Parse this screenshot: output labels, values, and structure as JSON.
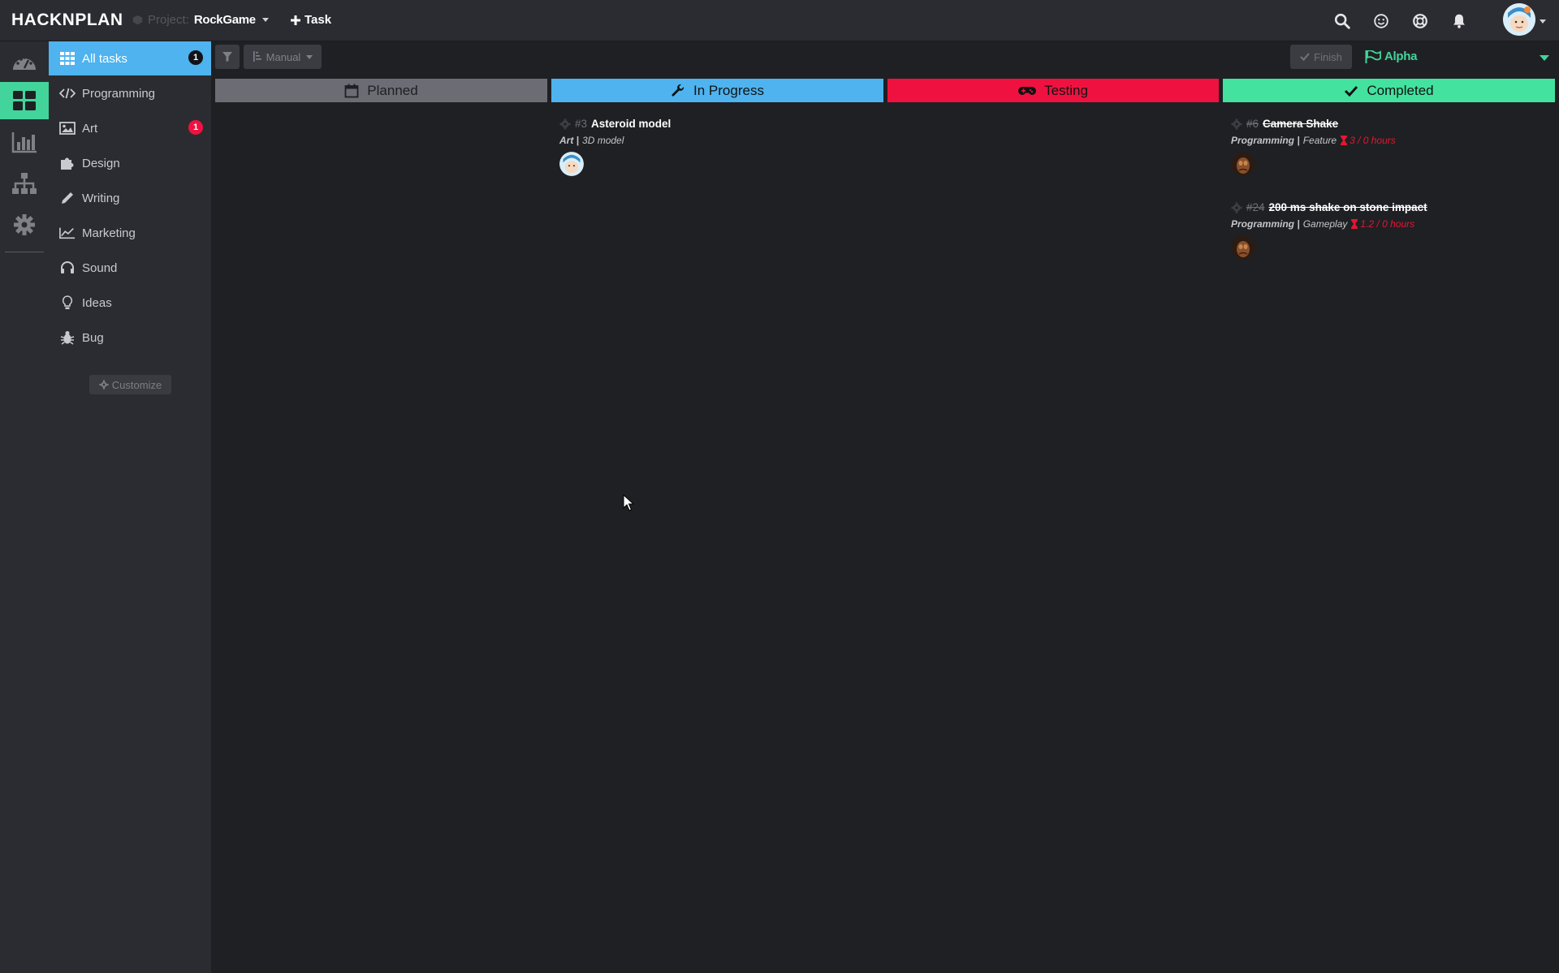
{
  "app": {
    "logo": "HACKNPLAN",
    "project_label": "Project:",
    "project_name": "RockGame",
    "add_task_label": "Task"
  },
  "topbar_icons": [
    "search-icon",
    "smiley-icon",
    "lifebuoy-icon",
    "bell-icon"
  ],
  "rail": [
    "dashboard-icon",
    "board-icon",
    "chart-icon",
    "hierarchy-icon",
    "gear-icon"
  ],
  "sidebar": {
    "items": [
      {
        "label": "All tasks",
        "icon": "grid-icon",
        "badge": "1"
      },
      {
        "label": "Programming",
        "icon": "code-icon",
        "badge": ""
      },
      {
        "label": "Art",
        "icon": "image-icon",
        "badge": "1"
      },
      {
        "label": "Design",
        "icon": "puzzle-icon",
        "badge": ""
      },
      {
        "label": "Writing",
        "icon": "pencil-icon",
        "badge": ""
      },
      {
        "label": "Marketing",
        "icon": "line-chart-icon",
        "badge": ""
      },
      {
        "label": "Sound",
        "icon": "headphones-icon",
        "badge": ""
      },
      {
        "label": "Ideas",
        "icon": "lightbulb-icon",
        "badge": ""
      },
      {
        "label": "Bug",
        "icon": "bug-icon",
        "badge": ""
      }
    ],
    "customize_label": "Customize"
  },
  "toolbar": {
    "sort_label": "Manual",
    "finish_label": "Finish",
    "milestone_label": "Alpha"
  },
  "colors": {
    "planned": "#6c6d74",
    "in_progress": "#4eb3ee",
    "testing": "#ef1240",
    "completed": "#43e29f",
    "accent": "#43d49b"
  },
  "columns": [
    {
      "label": "Planned",
      "icon": "calendar-icon"
    },
    {
      "label": "In Progress",
      "icon": "wrench-icon"
    },
    {
      "label": "Testing",
      "icon": "gamepad-icon"
    },
    {
      "label": "Completed",
      "icon": "check-icon"
    }
  ],
  "cards": {
    "asteroid": {
      "number": "#3",
      "title": "Asteroid model",
      "category": "Art |",
      "subcategory": "3D model",
      "estimate": ""
    },
    "camera_shake": {
      "number": "#6",
      "title": "Camera Shake",
      "category": "Programming |",
      "subcategory": "Feature",
      "estimate": "3 / 0 hours"
    },
    "stone_impact": {
      "number": "#24",
      "title": "200 ms shake on stone impact",
      "category": "Programming |",
      "subcategory": "Gameplay",
      "estimate": "1.2 / 0 hours"
    }
  }
}
